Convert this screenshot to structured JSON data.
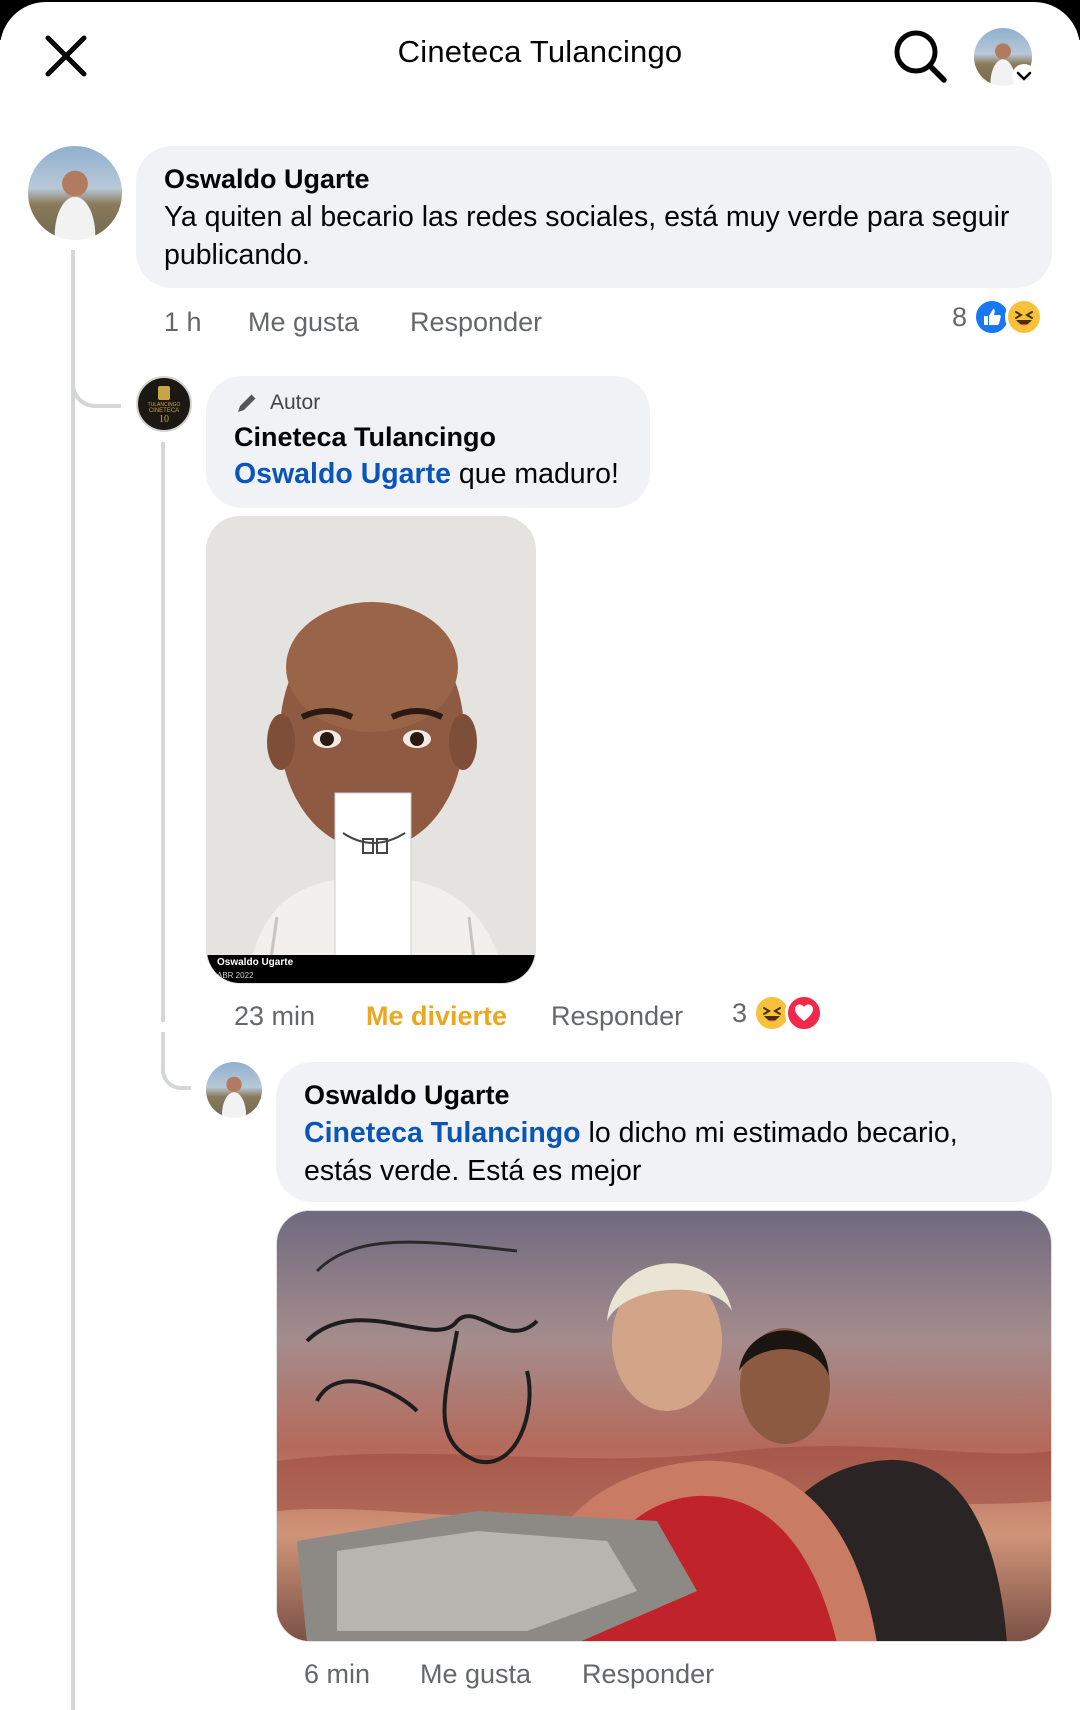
{
  "header": {
    "title": "Cineteca Tulancingo",
    "close_icon": "close-icon",
    "search_icon": "search-icon",
    "avatar_icon": "profile-avatar"
  },
  "comments": [
    {
      "author": "Oswaldo Ugarte",
      "text": "Ya quiten al becario las redes sociales, está muy verde para seguir publicando.",
      "time": "1 h",
      "like_label": "Me gusta",
      "reply_label": "Responder",
      "reaction_count": "8",
      "reactions": [
        "like-icon",
        "haha-icon"
      ]
    },
    {
      "badge": "Autor",
      "badge_icon": "pencil-icon",
      "author": "Cineteca Tulancingo",
      "mention": "Oswaldo Ugarte",
      "text": " que maduro!",
      "image_caption_name": "Oswaldo Ugarte",
      "image_caption_date": "ABR 2022",
      "time": "23 min",
      "like_label": "Me divierte",
      "reply_label": "Responder",
      "reaction_count": "3",
      "reactions": [
        "haha-icon",
        "love-icon"
      ]
    },
    {
      "author": "Oswaldo Ugarte",
      "mention": "Cineteca Tulancingo",
      "text": " lo dicho mi estimado becario, estás verde. Está es mejor",
      "time": "6 min",
      "like_label": "Me gusta",
      "reply_label": "Responder"
    }
  ],
  "colors": {
    "bubble": "#f0f2f5",
    "mention": "#0a56b8",
    "meta_text": "#65676b",
    "haha_reaction": "#e9a722"
  }
}
